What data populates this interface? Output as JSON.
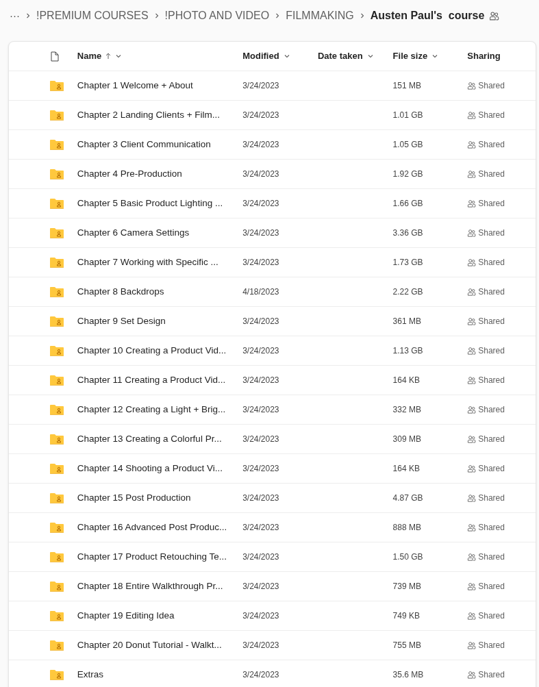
{
  "breadcrumb": {
    "overflow": "···",
    "items": [
      {
        "label": "!PREMIUM COURSES",
        "current": false
      },
      {
        "label": "!PHOTO AND VIDEO",
        "current": false
      },
      {
        "label": "FILMMAKING",
        "current": false
      },
      {
        "label": "Austen Paul's  course",
        "current": true
      }
    ]
  },
  "table": {
    "columns": [
      {
        "label": "Name",
        "sorted": true,
        "menu": true
      },
      {
        "label": "Modified",
        "sorted": false,
        "menu": true
      },
      {
        "label": "Date taken",
        "sorted": false,
        "menu": true
      },
      {
        "label": "File size",
        "sorted": false,
        "menu": true
      },
      {
        "label": "Sharing",
        "sorted": false,
        "menu": false
      }
    ],
    "rows": [
      {
        "name": "Chapter 1 Welcome + About",
        "modified": "3/24/2023",
        "size": "151 MB",
        "sharing": "Shared"
      },
      {
        "name": "Chapter 2 Landing Clients + Film...",
        "modified": "3/24/2023",
        "size": "1.01 GB",
        "sharing": "Shared"
      },
      {
        "name": "Chapter 3 Client Communication",
        "modified": "3/24/2023",
        "size": "1.05 GB",
        "sharing": "Shared"
      },
      {
        "name": "Chapter 4 Pre-Production",
        "modified": "3/24/2023",
        "size": "1.92 GB",
        "sharing": "Shared"
      },
      {
        "name": "Chapter 5 Basic Product Lighting ...",
        "modified": "3/24/2023",
        "size": "1.66 GB",
        "sharing": "Shared"
      },
      {
        "name": "Chapter 6 Camera Settings",
        "modified": "3/24/2023",
        "size": "3.36 GB",
        "sharing": "Shared"
      },
      {
        "name": "Chapter 7 Working with Specific ...",
        "modified": "3/24/2023",
        "size": "1.73 GB",
        "sharing": "Shared"
      },
      {
        "name": "Chapter 8 Backdrops",
        "modified": "4/18/2023",
        "size": "2.22 GB",
        "sharing": "Shared"
      },
      {
        "name": "Chapter 9 Set Design",
        "modified": "3/24/2023",
        "size": "361 MB",
        "sharing": "Shared"
      },
      {
        "name": "Chapter 10 Creating a Product Vid...",
        "modified": "3/24/2023",
        "size": "1.13 GB",
        "sharing": "Shared"
      },
      {
        "name": "Chapter 11 Creating a Product Vid...",
        "modified": "3/24/2023",
        "size": "164 KB",
        "sharing": "Shared"
      },
      {
        "name": "Chapter 12 Creating a Light + Brig...",
        "modified": "3/24/2023",
        "size": "332 MB",
        "sharing": "Shared"
      },
      {
        "name": "Chapter 13 Creating a Colorful Pr...",
        "modified": "3/24/2023",
        "size": "309 MB",
        "sharing": "Shared"
      },
      {
        "name": "Chapter 14 Shooting a Product Vi...",
        "modified": "3/24/2023",
        "size": "164 KB",
        "sharing": "Shared"
      },
      {
        "name": "Chapter 15 Post Production",
        "modified": "3/24/2023",
        "size": "4.87 GB",
        "sharing": "Shared"
      },
      {
        "name": "Chapter 16 Advanced Post Produc...",
        "modified": "3/24/2023",
        "size": "888 MB",
        "sharing": "Shared"
      },
      {
        "name": "Chapter 17 Product Retouching Te...",
        "modified": "3/24/2023",
        "size": "1.50 GB",
        "sharing": "Shared"
      },
      {
        "name": "Chapter 18 Entire Walkthrough Pr...",
        "modified": "3/24/2023",
        "size": "739 MB",
        "sharing": "Shared"
      },
      {
        "name": "Chapter 19 Editing Idea",
        "modified": "3/24/2023",
        "size": "749 KB",
        "sharing": "Shared"
      },
      {
        "name": "Chapter 20 Donut Tutorial - Walkt...",
        "modified": "3/24/2023",
        "size": "755 MB",
        "sharing": "Shared"
      },
      {
        "name": "Extras",
        "modified": "3/24/2023",
        "size": "35.6 MB",
        "sharing": "Shared"
      }
    ]
  }
}
